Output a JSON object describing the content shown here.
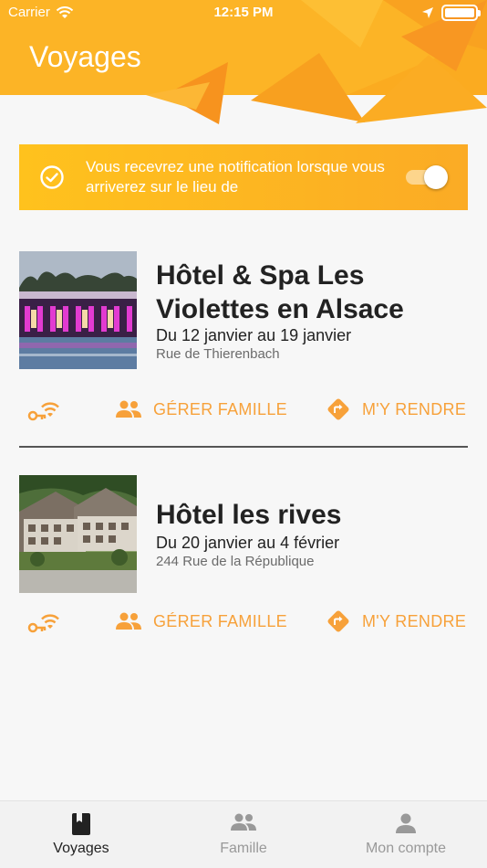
{
  "status_bar": {
    "carrier": "Carrier",
    "time": "12:15 PM"
  },
  "header": {
    "title": "Voyages"
  },
  "notification": {
    "text": "Vous recevrez une notification lorsque vous arriverez sur le lieu de",
    "toggle_on": true
  },
  "trips": [
    {
      "name": "Hôtel & Spa Les Violettes en Alsace",
      "dates": "Du 12 janvier au 19 janvier",
      "address": "Rue de Thierenbach",
      "actions": {
        "family": "GÉRER FAMILLE",
        "directions": "M'Y RENDRE"
      }
    },
    {
      "name": "Hôtel les rives",
      "dates": "Du 20 janvier au 4 février",
      "address": "244 Rue de la République",
      "actions": {
        "family": "GÉRER FAMILLE",
        "directions": "M'Y RENDRE"
      }
    }
  ],
  "tab_bar": {
    "tabs": [
      {
        "label": "Voyages",
        "icon": "book-icon",
        "active": true
      },
      {
        "label": "Famille",
        "icon": "people-icon",
        "active": false
      },
      {
        "label": "Mon compte",
        "icon": "person-icon",
        "active": false
      }
    ]
  },
  "colors": {
    "accent": "#f7a13a",
    "banner": "#fbb323",
    "header_orange": "#fca61f"
  }
}
